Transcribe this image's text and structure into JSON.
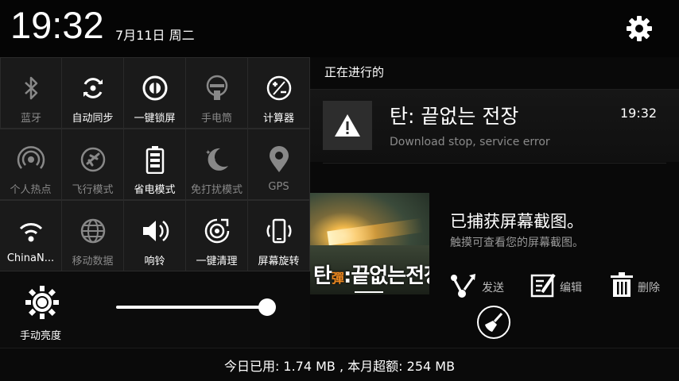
{
  "status": {
    "time": "19:32",
    "date": "7月11日 周二"
  },
  "toggles": [
    {
      "label": "蓝牙",
      "icon": "bluetooth-icon",
      "on": false
    },
    {
      "label": "自动同步",
      "icon": "sync-icon",
      "on": true
    },
    {
      "label": "一键锁屏",
      "icon": "lock-screen-icon",
      "on": true
    },
    {
      "label": "手电筒",
      "icon": "flashlight-icon",
      "on": false
    },
    {
      "label": "计算器",
      "icon": "calculator-icon",
      "on": true
    },
    {
      "label": "个人热点",
      "icon": "hotspot-icon",
      "on": false
    },
    {
      "label": "飞行模式",
      "icon": "airplane-icon",
      "on": false
    },
    {
      "label": "省电模式",
      "icon": "battery-saver-icon",
      "on": true
    },
    {
      "label": "免打扰模式",
      "icon": "do-not-disturb-icon",
      "on": false
    },
    {
      "label": "GPS",
      "icon": "gps-icon",
      "on": false
    },
    {
      "label": "ChinaN...",
      "icon": "wifi-icon",
      "on": true
    },
    {
      "label": "移动数据",
      "icon": "mobile-data-icon",
      "on": false
    },
    {
      "label": "响铃",
      "icon": "ringer-icon",
      "on": true
    },
    {
      "label": "一键清理",
      "icon": "quick-clean-icon",
      "on": true
    },
    {
      "label": "屏幕旋转",
      "icon": "screen-rotate-icon",
      "on": true
    }
  ],
  "brightness": {
    "label": "手动亮度",
    "level": 0.95
  },
  "notifications": {
    "header": "正在进行的",
    "item": {
      "title": "탄: 끝없는 전장",
      "subtitle": "Download stop, service error",
      "time": "19:32",
      "icon": "warning-icon"
    }
  },
  "screenshot": {
    "title": "已捕获屏幕截图。",
    "subtitle": "触摸可查看您的屏幕截图。",
    "thumb_logo_main": "탄",
    "thumb_logo_accent": "彈",
    "thumb_logo_rest": ":끝없는전장",
    "actions": {
      "send": "发送",
      "edit": "编辑",
      "delete": "删除"
    }
  },
  "footer": {
    "usage": "今日已用: 1.74 MB , 本月超额: 254 MB"
  },
  "colors": {
    "active": "#ffffff",
    "inactive": "#888888",
    "tile_bg": "#1a1a1a"
  }
}
